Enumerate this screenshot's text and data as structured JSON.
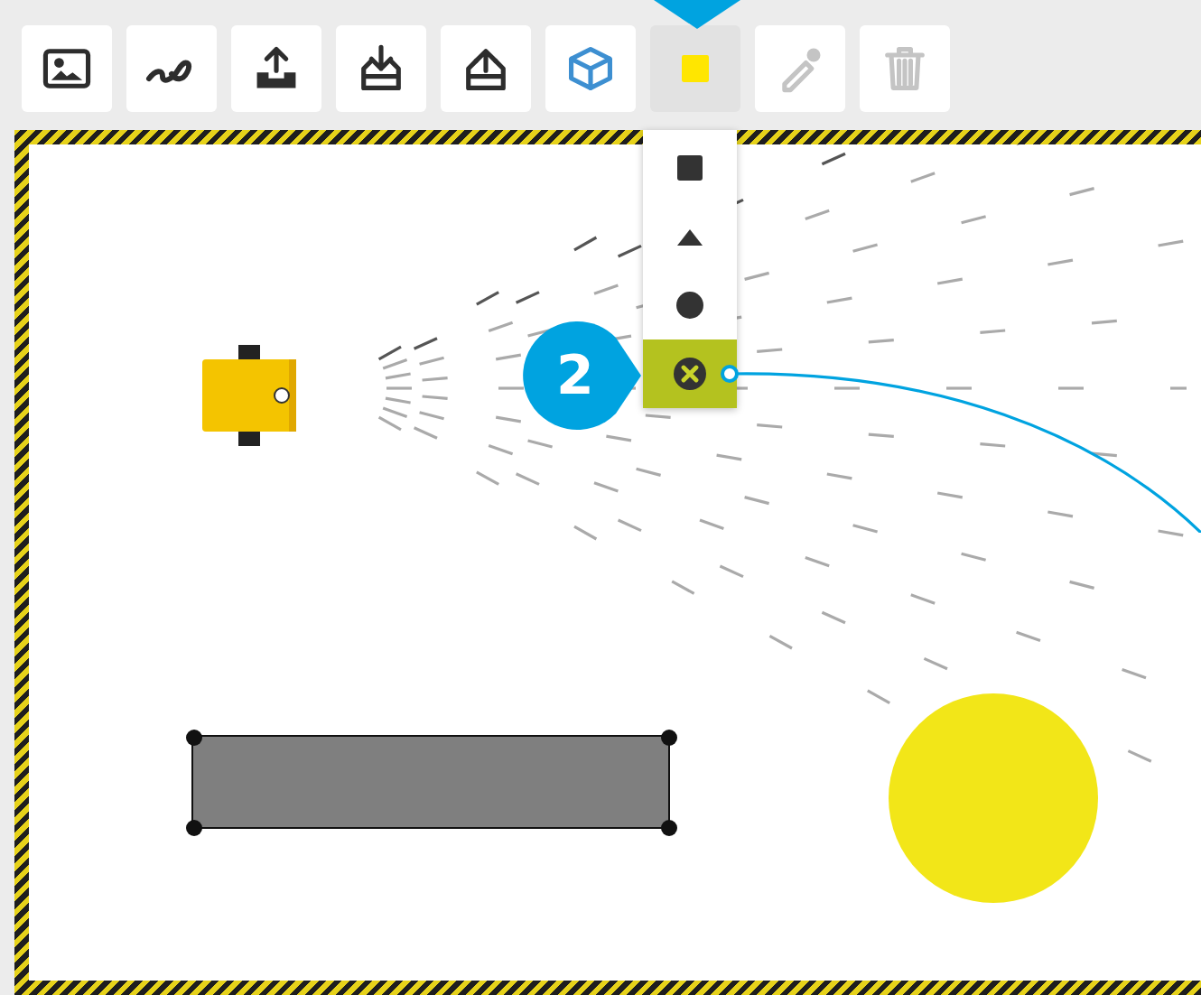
{
  "toolbar": {
    "tools": [
      {
        "kind": "image",
        "selected": false,
        "disabled": false
      },
      {
        "kind": "link",
        "selected": false,
        "disabled": false
      },
      {
        "kind": "upload",
        "selected": false,
        "disabled": false
      },
      {
        "kind": "download",
        "selected": false,
        "disabled": false
      },
      {
        "kind": "export",
        "selected": false,
        "disabled": false
      },
      {
        "kind": "cube",
        "selected": false,
        "disabled": false
      },
      {
        "kind": "color",
        "selected": true,
        "disabled": false
      },
      {
        "kind": "eyedropper",
        "selected": false,
        "disabled": true
      },
      {
        "kind": "trash",
        "selected": false,
        "disabled": true
      }
    ]
  },
  "shape_menu": {
    "expanded": true,
    "items": [
      {
        "kind": "square",
        "selected": false
      },
      {
        "kind": "triangle",
        "selected": false
      },
      {
        "kind": "circle",
        "selected": false
      },
      {
        "kind": "clear",
        "selected": true
      }
    ]
  },
  "canvas": {
    "objects": [
      {
        "kind": "robot",
        "selected": false
      },
      {
        "kind": "rectangle",
        "selected": true
      },
      {
        "kind": "circle",
        "selected": false
      }
    ]
  },
  "callout": {
    "number": "2"
  }
}
